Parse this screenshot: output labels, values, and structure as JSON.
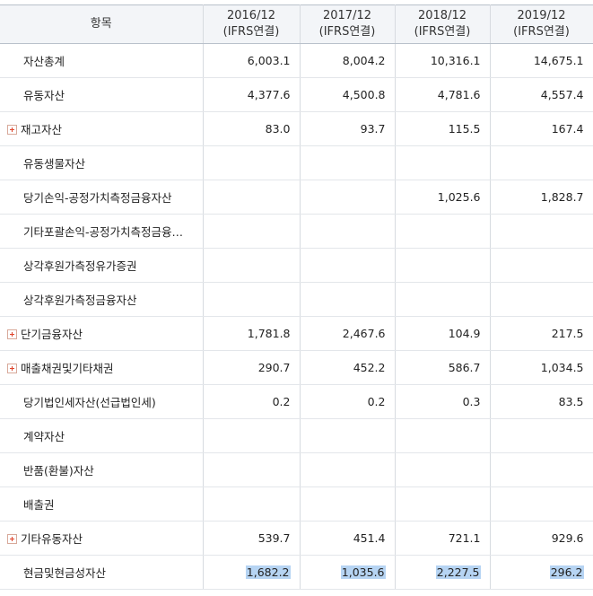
{
  "header": {
    "item_label": "항목",
    "periods": [
      {
        "year": "2016/12",
        "basis": "(IFRS연결)"
      },
      {
        "year": "2017/12",
        "basis": "(IFRS연결)"
      },
      {
        "year": "2018/12",
        "basis": "(IFRS연결)"
      },
      {
        "year": "2019/12",
        "basis": "(IFRS연결)"
      }
    ]
  },
  "rows": [
    {
      "label": "자산총계",
      "values": [
        "6,003.1",
        "8,004.2",
        "10,316.1",
        "14,675.1"
      ]
    },
    {
      "label": "유동자산",
      "values": [
        "4,377.6",
        "4,500.8",
        "4,781.6",
        "4,557.4"
      ]
    },
    {
      "label": "재고자산",
      "values": [
        "83.0",
        "93.7",
        "115.5",
        "167.4"
      ]
    },
    {
      "label": "유동생물자산",
      "values": [
        "",
        "",
        "",
        ""
      ]
    },
    {
      "label": "당기손익-공정가치측정금융자산",
      "values": [
        "",
        "",
        "1,025.6",
        "1,828.7"
      ]
    },
    {
      "label": "기타포괄손익-공정가치측정금융…",
      "values": [
        "",
        "",
        "",
        ""
      ]
    },
    {
      "label": "상각후원가측정유가증권",
      "values": [
        "",
        "",
        "",
        ""
      ]
    },
    {
      "label": "상각후원가측정금융자산",
      "values": [
        "",
        "",
        "",
        ""
      ]
    },
    {
      "label": "단기금융자산",
      "values": [
        "1,781.8",
        "2,467.6",
        "104.9",
        "217.5"
      ]
    },
    {
      "label": "매출채권및기타채권",
      "values": [
        "290.7",
        "452.2",
        "586.7",
        "1,034.5"
      ]
    },
    {
      "label": "당기법인세자산(선급법인세)",
      "values": [
        "0.2",
        "0.2",
        "0.3",
        "83.5"
      ]
    },
    {
      "label": "계약자산",
      "values": [
        "",
        "",
        "",
        ""
      ]
    },
    {
      "label": "반품(환불)자산",
      "values": [
        "",
        "",
        "",
        ""
      ]
    },
    {
      "label": "배출권",
      "values": [
        "",
        "",
        "",
        ""
      ]
    },
    {
      "label": "기타유동자산",
      "values": [
        "539.7",
        "451.4",
        "721.1",
        "929.6"
      ]
    },
    {
      "label": "현금및현금성자산",
      "values": [
        "1,682.2",
        "1,035.6",
        "2,227.5",
        "296.2"
      ]
    }
  ],
  "colors": {
    "header_bg": "#f3f5f8",
    "border": "#d7dbe0",
    "expand_icon": "#e0432a",
    "selection": "#b6d4f3"
  },
  "icons": {
    "expand": "plus-square-icon"
  }
}
